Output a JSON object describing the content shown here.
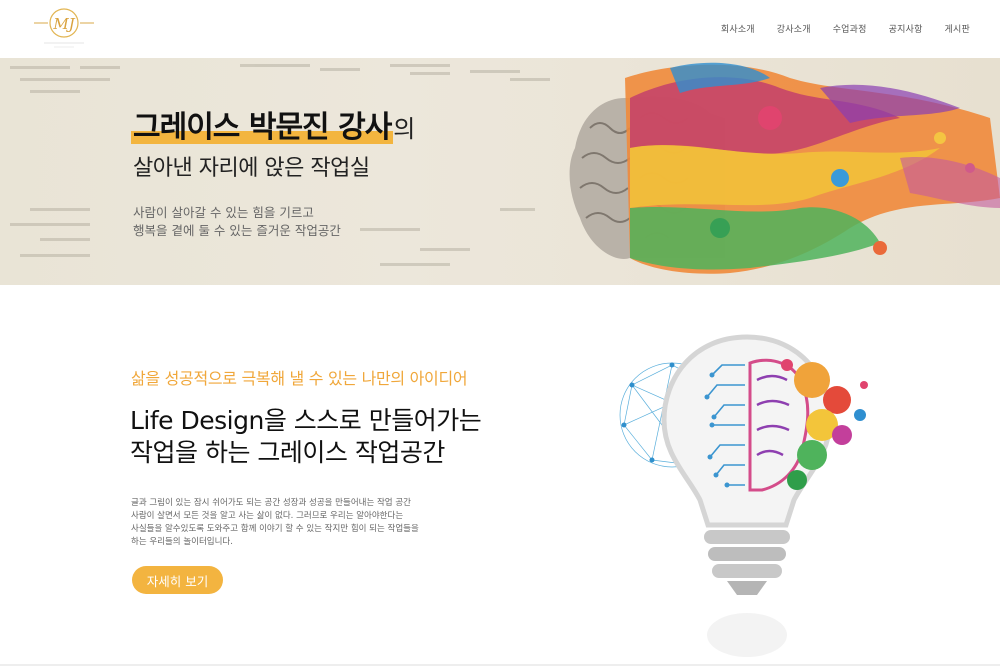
{
  "header": {
    "logo_letters": "MJ",
    "nav": [
      "회사소개",
      "강사소개",
      "수업과정",
      "공지사항",
      "게시판"
    ]
  },
  "hero": {
    "title": "그레이스 박문진 강사",
    "title_suffix": "의",
    "subtitle": "살아낸 자리에 앉은 작업실",
    "desc_line1": "사람이 살아갈 수 있는 힘을 기르고",
    "desc_line2": "행복을 곁에 둘 수 있는 즐거운 작업공간"
  },
  "intro": {
    "tagline": "삶을 성공적으로 극복해 낼 수 있는 나만의 아이디어",
    "title_line1": "Life Design을 스스로 만들어가는",
    "title_line2": "작업을 하는 그레이스 작업공간",
    "body_line1": "글과 그림이 있는 잠시 쉬어가도 되는 공간 성장과 성공을 만들어내는 작업 공간",
    "body_line2": "사람이 살면서 모든 것을 알고 사는 삶이 없다. 그러므로 우리는 알아야한다는",
    "body_line3": "사실들을 알수있도록 도와주고 함께 이야기 할 수 있는 작지만 힘이 되는 작업들을",
    "body_line4": "하는 우리들의 놀이터입니다.",
    "cta_label": "자세히 보기"
  },
  "colors": {
    "accent": "#f3b440",
    "tagline": "#f0a73a",
    "hero_bg": "#ebe5d8"
  }
}
